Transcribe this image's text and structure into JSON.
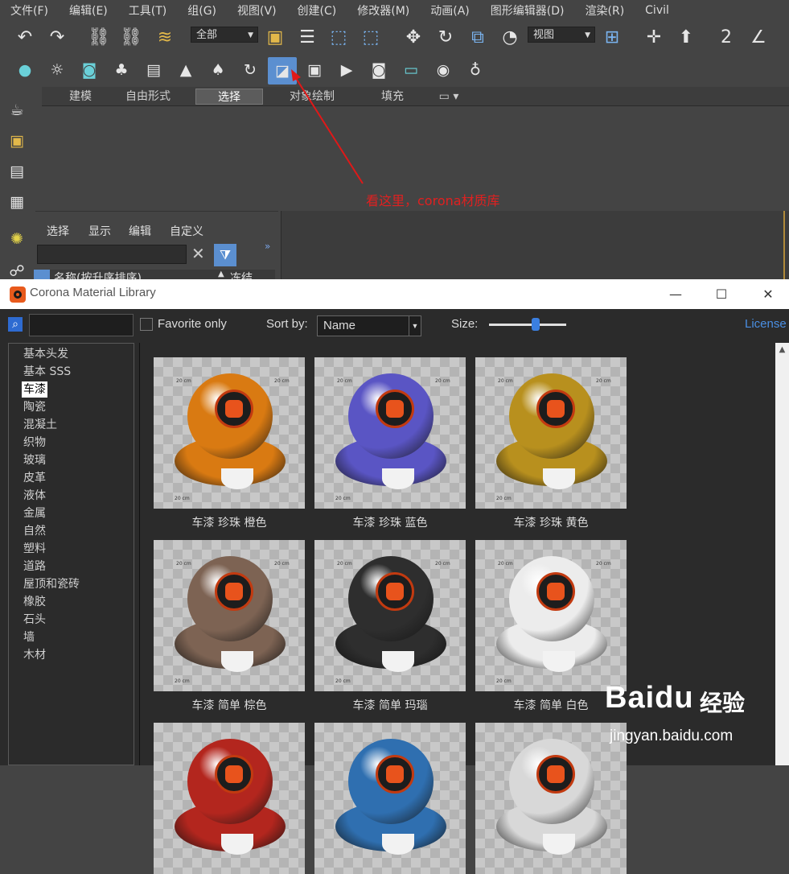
{
  "menubar": [
    "文件(F)",
    "编辑(E)",
    "工具(T)",
    "组(G)",
    "视图(V)",
    "创建(C)",
    "修改器(M)",
    "动画(A)",
    "图形编辑器(D)",
    "渲染(R)",
    "Civil"
  ],
  "toolbar": {
    "selection_filter": "全部",
    "reference_coord": "视图"
  },
  "ribbon_tabs": [
    "建模",
    "自由形式",
    "选择",
    "对象绘制",
    "填充"
  ],
  "ribbon_active_tab": "选择",
  "annotation": "看这里，corona材质库",
  "scene_explorer": {
    "menu": [
      "选择",
      "显示",
      "编辑",
      "自定义"
    ],
    "column_header": "名称(按升序排序)",
    "column_header2": "冻结"
  },
  "corona_library": {
    "title": "Corona Material Library",
    "favorite_label": "Favorite only",
    "sort_label": "Sort by:",
    "sort_value": "Name",
    "size_label": "Size:",
    "size_slider_fraction": 0.6,
    "license_label": "License",
    "categories": [
      "基本头发",
      "基本 SSS",
      "车漆",
      "陶瓷",
      "混凝土",
      "织物",
      "玻璃",
      "皮革",
      "液体",
      "金属",
      "自然",
      "塑料",
      "道路",
      "屋顶和瓷砖",
      "橡胶",
      "石头",
      "墙",
      "木材"
    ],
    "selected_category": "车漆",
    "materials": [
      {
        "name": "车漆 珍珠 橙色",
        "color": "#d97a12"
      },
      {
        "name": "车漆 珍珠 蓝色",
        "color": "#5a55c4"
      },
      {
        "name": "车漆 珍珠 黄色",
        "color": "#b8901e"
      },
      {
        "name": "车漆 简单 棕色",
        "color": "#7d6353"
      },
      {
        "name": "车漆 简单 玛瑙",
        "color": "#2e2e2e"
      },
      {
        "name": "车漆 简单 白色",
        "color": "#ececec"
      },
      {
        "name": "",
        "color": "#b3261e"
      },
      {
        "name": "",
        "color": "#2f6fb0"
      },
      {
        "name": "",
        "color": "#d8d8d8"
      }
    ],
    "thumb_labels": [
      "20 cm",
      "20 cm",
      "20 cm"
    ]
  },
  "watermark": {
    "brand": "Baidu",
    "cn": "经验",
    "url": "jingyan.baidu.com"
  }
}
